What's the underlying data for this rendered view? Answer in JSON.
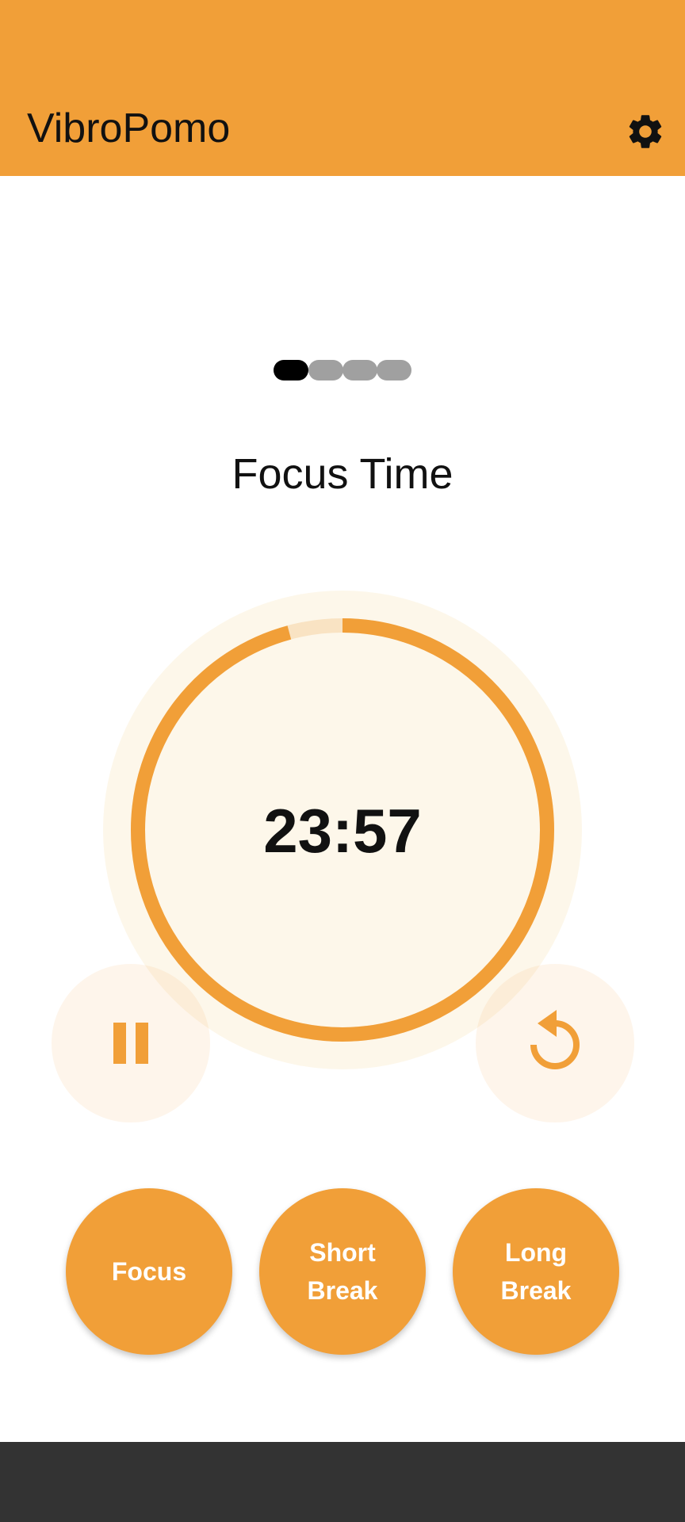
{
  "app": {
    "title": "VibroPomo",
    "settings_icon": "gear-icon"
  },
  "session_indicators": {
    "count": 4,
    "active_index": 0
  },
  "timer": {
    "mode_title": "Focus Time",
    "remaining": "23:57",
    "progress_fraction": 0.958
  },
  "controls": {
    "pause_icon": "pause-icon",
    "reset_icon": "reset-icon"
  },
  "modes": {
    "focus_label": "Focus",
    "short_break_label": "Short Break",
    "long_break_label": "Long Break"
  },
  "colors": {
    "accent": "#F19F38",
    "accent_light": "#FDF7EA",
    "track": "#F9E3C3",
    "nav_bar": "#333333"
  }
}
